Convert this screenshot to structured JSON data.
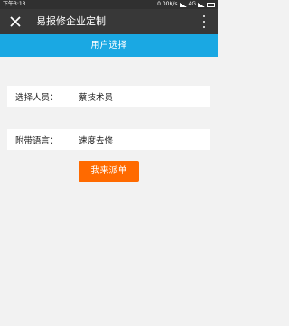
{
  "status_bar": {
    "time": "下午3:13",
    "network_speed": "0.00K/s",
    "network_type": "4G"
  },
  "app_bar": {
    "title": "易报修企业定制"
  },
  "header": {
    "title": "用户选择"
  },
  "form": {
    "fields": [
      {
        "label": "选择人员：",
        "value": "蔡技术员"
      },
      {
        "label": "附带语言：",
        "value": "速度去修"
      }
    ]
  },
  "submit_label": "我来派单",
  "colors": {
    "status_bar": "#303030",
    "app_bar": "#383838",
    "header": "#1aa8e3",
    "submit": "#ff6a00",
    "background": "#f2f2f2"
  }
}
